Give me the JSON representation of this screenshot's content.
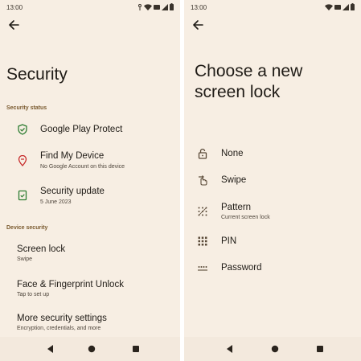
{
  "left": {
    "status_time": "13:00",
    "title": "Security",
    "section_status": "Security status",
    "items": [
      {
        "label": "Google Play Protect"
      },
      {
        "label": "Find My Device",
        "sub": "No Google Account on this device"
      },
      {
        "label": "Security update",
        "sub": "5 June 2023"
      }
    ],
    "section_device": "Device security",
    "device_items": [
      {
        "label": "Screen lock",
        "sub": "Swipe"
      },
      {
        "label": "Face & Fingerprint Unlock",
        "sub": "Tap to set up"
      },
      {
        "label": "More security settings",
        "sub": "Encryption, credentials, and more"
      }
    ]
  },
  "right": {
    "status_time": "13:00",
    "title": "Choose a new screen lock",
    "options": [
      {
        "label": "None"
      },
      {
        "label": "Swipe"
      },
      {
        "label": "Pattern",
        "sub": "Current screen lock"
      },
      {
        "label": "PIN"
      },
      {
        "label": "Password"
      }
    ]
  },
  "colors": {
    "background": "#f7eee3",
    "protect_green": "#2e7d32",
    "find_device_red": "#c62828",
    "accent_brown": "#7a5a2f"
  }
}
